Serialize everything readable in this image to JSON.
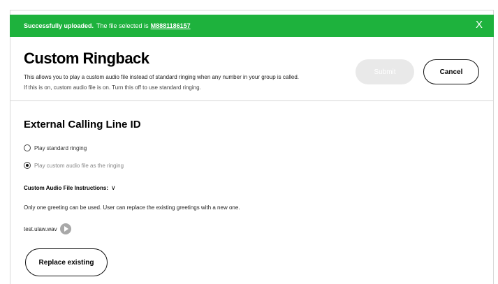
{
  "banner": {
    "status_bold": "Successfully uploaded.",
    "status_text": "The file selected is",
    "file_name": "M8881186157",
    "close_glyph": "X",
    "color": "#1eb23d"
  },
  "header": {
    "title": "Custom Ringback",
    "description": "This allows you to play a custom audio file instead of standard ringing when any number in your group is called.",
    "description2": "If this is on, custom audio file is on. Turn this off to use standard ringing.",
    "submit_label": "Submit",
    "cancel_label": "Cancel"
  },
  "section": {
    "title": "External Calling Line ID",
    "options": [
      {
        "label": "Play standard ringing",
        "selected": false
      },
      {
        "label": "Play custom audio file as the ringing",
        "selected": true
      }
    ],
    "instructions_label": "Custom Audio File Instructions:",
    "instructions_icon": "chevron-down-icon",
    "note": "Only one greeting can be used. User can replace the existing greetings with a new one.",
    "file_name": "test.ulaw.wav",
    "play_icon": "play-icon",
    "replace_label": "Replace existing"
  }
}
